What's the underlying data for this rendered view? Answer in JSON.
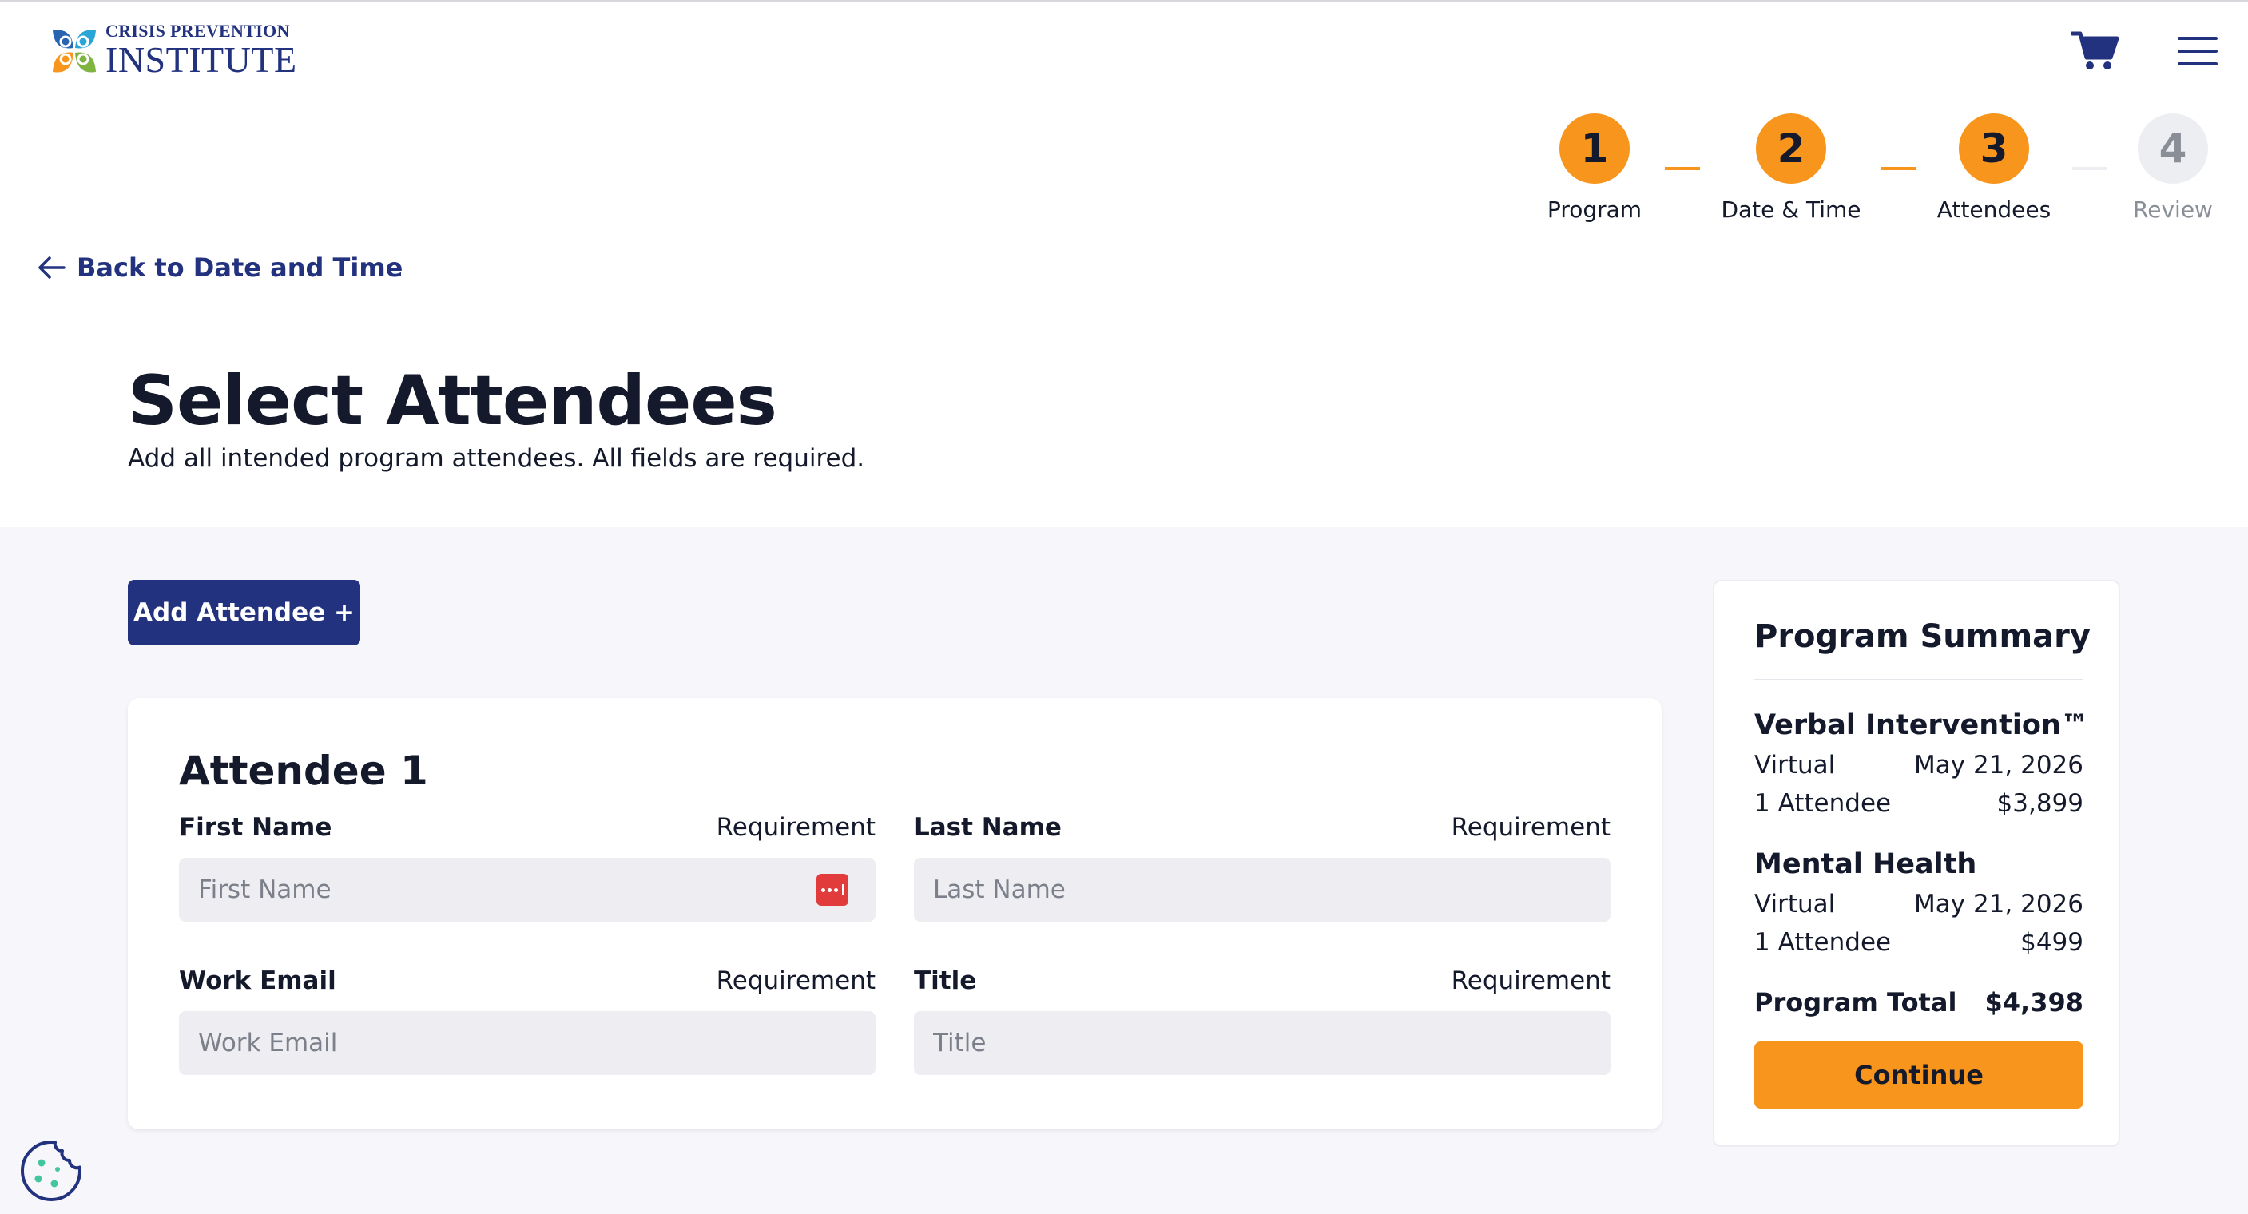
{
  "header": {
    "logo_small": "CRISIS PREVENTION",
    "logo_big": "INSTITUTE",
    "cart_icon": "cart-icon",
    "menu_icon": "hamburger-menu-icon"
  },
  "stepper": {
    "steps": [
      {
        "number": "1",
        "label": "Program",
        "state": "complete"
      },
      {
        "number": "2",
        "label": "Date & Time",
        "state": "complete"
      },
      {
        "number": "3",
        "label": "Attendees",
        "state": "current"
      },
      {
        "number": "4",
        "label": "Review",
        "state": "upcoming"
      }
    ]
  },
  "back_link": "Back to Date and Time",
  "page": {
    "title": "Select Attendees",
    "subtitle": "Add all intended program attendees. All fields are required."
  },
  "add_attendee_label": "Add Attendee +",
  "attendee_card": {
    "title": "Attendee 1",
    "fields": {
      "first_name": {
        "label": "First Name",
        "requirement": "Requirement",
        "placeholder": "First Name",
        "value": ""
      },
      "last_name": {
        "label": "Last Name",
        "requirement": "Requirement",
        "placeholder": "Last Name",
        "value": ""
      },
      "work_email": {
        "label": "Work Email",
        "requirement": "Requirement",
        "placeholder": "Work Email",
        "value": ""
      },
      "title": {
        "label": "Title",
        "requirement": "Requirement",
        "placeholder": "Title",
        "value": ""
      }
    }
  },
  "summary": {
    "title": "Program Summary",
    "programs": [
      {
        "name": "Verbal Intervention™",
        "format": "Virtual",
        "date": "May 21, 2026",
        "attendees": "1 Attendee",
        "price": "$3,899"
      },
      {
        "name": "Mental Health",
        "format": "Virtual",
        "date": "May 21, 2026",
        "attendees": "1 Attendee",
        "price": "$499"
      }
    ],
    "total_label": "Program Total",
    "total_value": "$4,398",
    "continue_label": "Continue"
  },
  "colors": {
    "brand_navy": "#22327f",
    "accent_orange": "#f7951d",
    "inactive_gray": "#eceef2"
  }
}
